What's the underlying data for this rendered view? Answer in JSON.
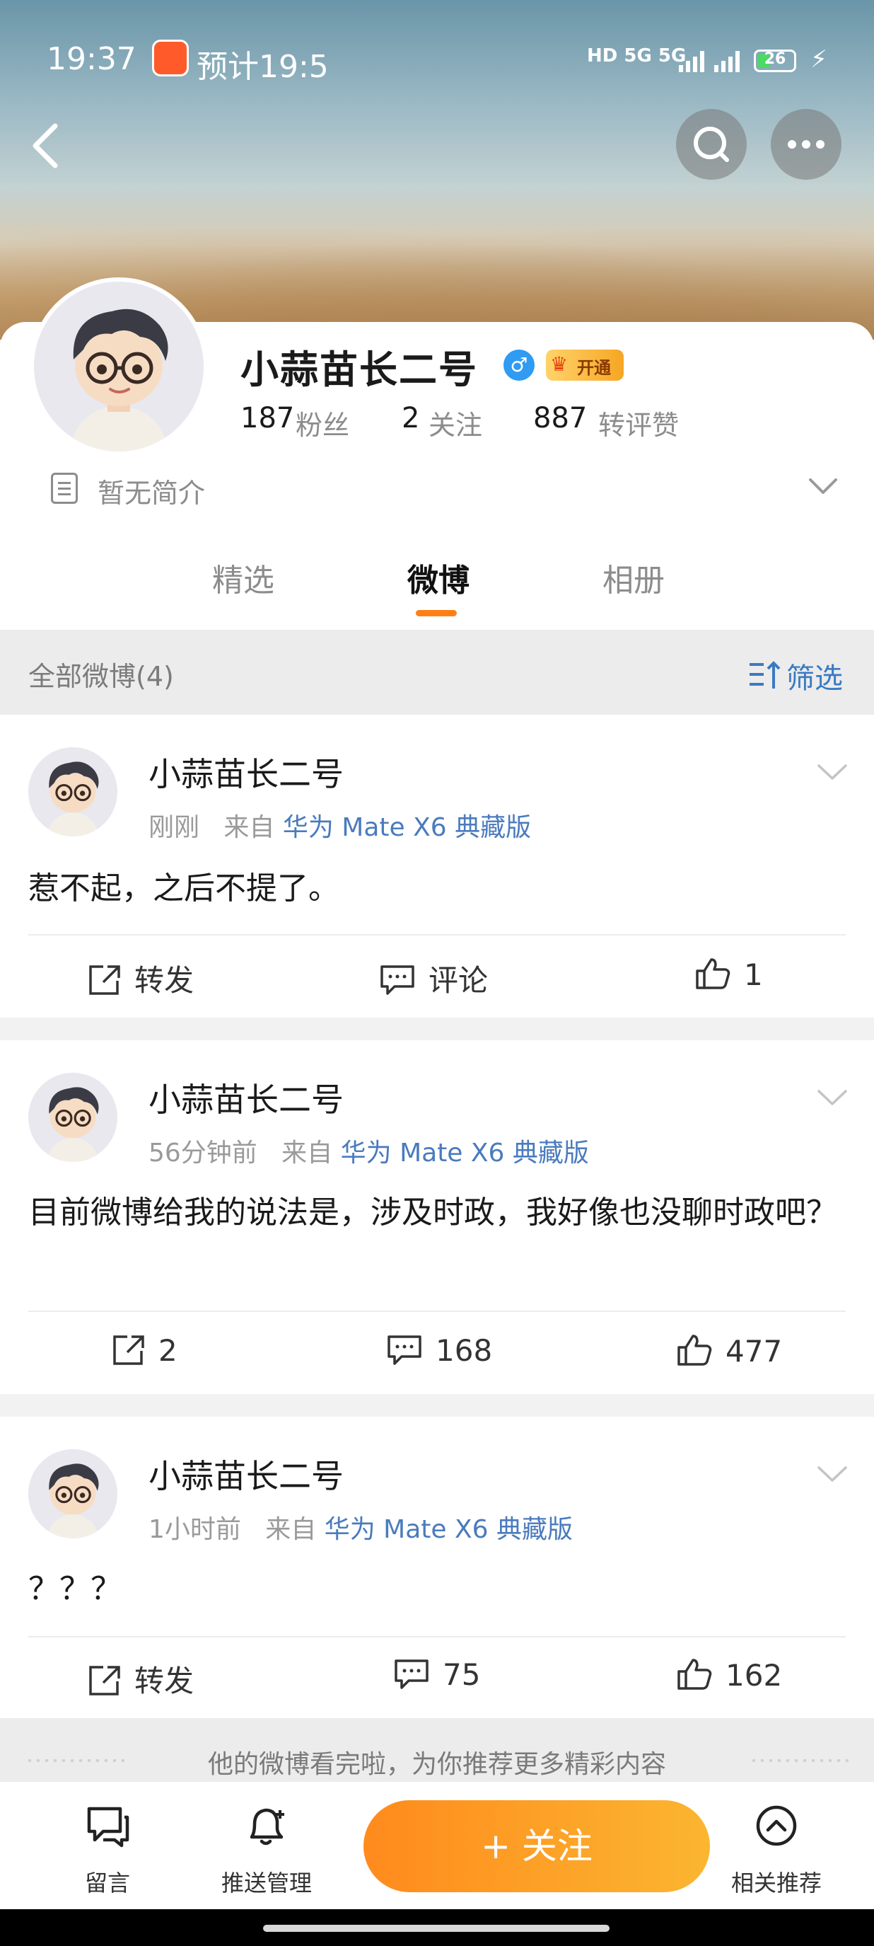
{
  "status_bar": {
    "time": "19:37",
    "eta": "预计19:5",
    "network": "HD 5G 5G",
    "battery": "26"
  },
  "profile": {
    "username": "小蒜苗长二号",
    "gender_symbol": "♂",
    "vip_label": "开通",
    "stats": [
      {
        "num": "187",
        "label": "粉丝"
      },
      {
        "num": "2",
        "label": "关注"
      },
      {
        "num": "887",
        "label": "转评赞"
      }
    ],
    "bio": "暂无简介"
  },
  "tabs": [
    "精选",
    "微博",
    "相册"
  ],
  "active_tab": "微博",
  "filter": {
    "all_label": "全部微博(4)",
    "filter_label": "筛选"
  },
  "posts": [
    {
      "author": "小蒜苗长二号",
      "time": "刚刚",
      "from": "来自",
      "source": "华为 Mate X6 典藏版",
      "text": "惹不起，之后不提了。",
      "repost": "转发",
      "comment": "评论",
      "like": "1"
    },
    {
      "author": "小蒜苗长二号",
      "time": "56分钟前",
      "from": "来自",
      "source": "华为 Mate X6 典藏版",
      "text": "目前微博给我的说法是，涉及时政，我好像也没聊时政吧？",
      "repost": "2",
      "comment": "168",
      "like": "477"
    },
    {
      "author": "小蒜苗长二号",
      "time": "1小时前",
      "from": "来自",
      "source": "华为 Mate X6 典藏版",
      "text": "？？？",
      "repost": "转发",
      "comment": "75",
      "like": "162"
    }
  ],
  "recommend_text": "他的微博看完啦，为你推荐更多精彩内容",
  "bottom_bar": {
    "message": "留言",
    "push": "推送管理",
    "follow": "+ 关注",
    "related": "相关推荐"
  },
  "colors": {
    "accent_orange": "#ff7f17",
    "link_blue": "#4a7bbd",
    "follow_gradient_start": "#ff8a1d",
    "follow_gradient_end": "#fbb630"
  }
}
